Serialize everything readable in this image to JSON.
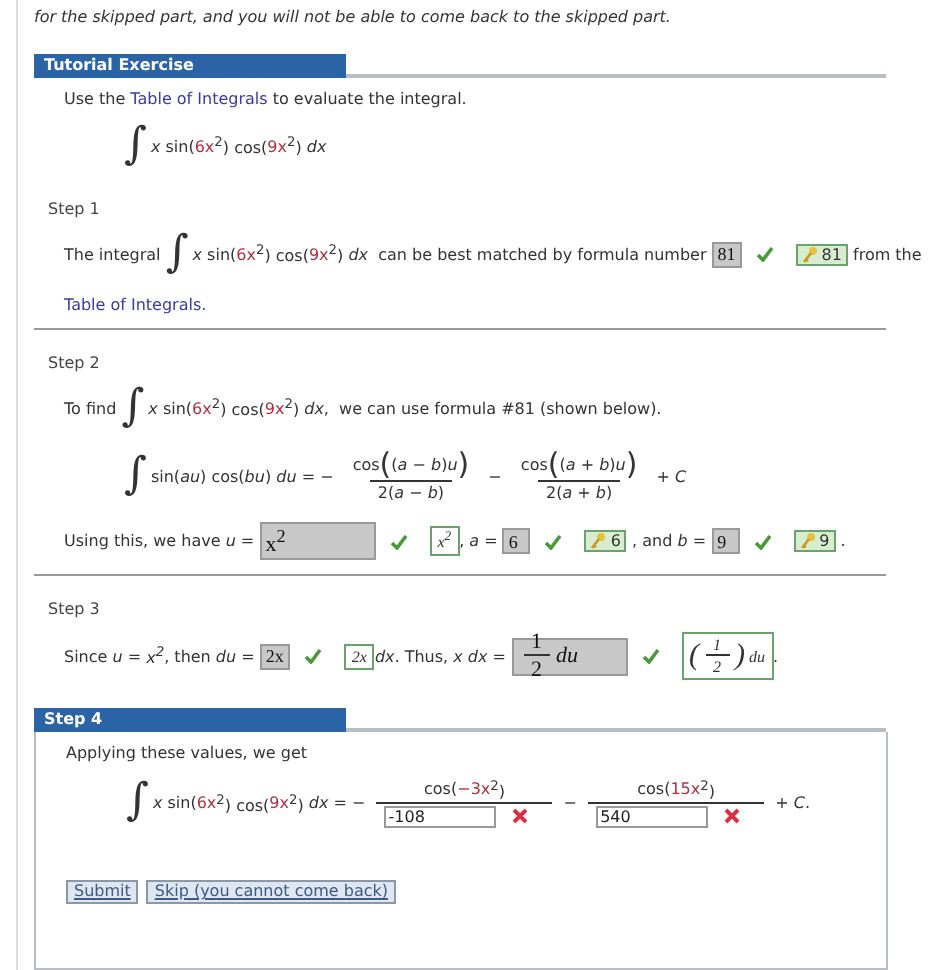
{
  "notice": "for the skipped part, and you will not be able to come back to the skipped part.",
  "tutorial": {
    "title": "Tutorial Exercise",
    "lines": [
      {
        "kind": "sentence",
        "tokens": [
          {
            "kind": "text",
            "text": "Use the "
          },
          {
            "kind": "link",
            "text": "Table of Integrals"
          },
          {
            "kind": "text",
            "text": " to evaluate the integral."
          }
        ]
      },
      {
        "kind": "display",
        "tokens": [
          {
            "kind": "int",
            "text": "∫"
          },
          {
            "kind": "var",
            "text": "x"
          },
          {
            "kind": "text",
            "text": " sin("
          },
          {
            "kind": "coef",
            "text": "6x"
          },
          {
            "kind": "text",
            "text": "$^{2}$) cos("
          },
          {
            "kind": "coef",
            "text": "9x"
          },
          {
            "kind": "text",
            "text": "$^{2}$) "
          },
          {
            "kind": "var",
            "text": "dx"
          }
        ]
      }
    ]
  },
  "steps": [
    {
      "label": "Step 1",
      "kind": "plain",
      "lines": [
        {
          "kind": "sentence",
          "tokens": [
            {
              "kind": "text",
              "text": "The integral "
            },
            {
              "kind": "int",
              "text": "∫"
            },
            {
              "kind": "var",
              "text": "x"
            },
            {
              "kind": "text",
              "text": " sin("
            },
            {
              "kind": "coef",
              "text": "6x"
            },
            {
              "kind": "text",
              "text": "$^{2}$) cos("
            },
            {
              "kind": "coef",
              "text": "9x"
            },
            {
              "kind": "text",
              "text": "$^{2}$) "
            },
            {
              "kind": "var",
              "text": "dx"
            },
            {
              "kind": "text",
              "text": "  can be best matched by formula number "
            },
            {
              "kind": "answer",
              "value": [
                {
                  "kind": "text",
                  "text": "81"
                }
              ],
              "correct": true,
              "key_icon": true,
              "key": [
                {
                  "kind": "text",
                  "text": "81"
                }
              ]
            },
            {
              "kind": "text",
              "text": " from the"
            }
          ]
        },
        {
          "kind": "sentence",
          "tokens": [
            {
              "kind": "link",
              "text": "Table of Integrals."
            }
          ]
        }
      ]
    },
    {
      "label": "Step 2",
      "kind": "plain",
      "lines": [
        {
          "kind": "sentence",
          "tokens": [
            {
              "kind": "text",
              "text": "To find "
            },
            {
              "kind": "int",
              "text": "∫"
            },
            {
              "kind": "var",
              "text": "x"
            },
            {
              "kind": "text",
              "text": " sin("
            },
            {
              "kind": "coef",
              "text": "6x"
            },
            {
              "kind": "text",
              "text": "$^{2}$) cos("
            },
            {
              "kind": "coef",
              "text": "9x"
            },
            {
              "kind": "text",
              "text": "$^{2}$) "
            },
            {
              "kind": "var",
              "text": "dx"
            },
            {
              "kind": "text",
              "text": ",  we can use formula #81 (shown below)."
            }
          ]
        },
        {
          "kind": "display",
          "tokens": [
            {
              "kind": "int",
              "text": "∫"
            },
            {
              "kind": "text",
              "text": "sin("
            },
            {
              "kind": "var",
              "text": "au"
            },
            {
              "kind": "text",
              "text": ") cos("
            },
            {
              "kind": "var",
              "text": "bu"
            },
            {
              "kind": "text",
              "text": ") "
            },
            {
              "kind": "var",
              "text": "du"
            },
            {
              "kind": "text",
              "text": " = − "
            },
            {
              "kind": "frac",
              "num": [
                {
                  "kind": "text",
                  "text": "cos"
                },
                {
                  "kind": "big",
                  "text": "("
                },
                {
                  "kind": "text",
                  "text": "("
                },
                {
                  "kind": "var",
                  "text": "a"
                },
                {
                  "kind": "text",
                  "text": " − "
                },
                {
                  "kind": "var",
                  "text": "b"
                },
                {
                  "kind": "text",
                  "text": ")"
                },
                {
                  "kind": "var",
                  "text": "u"
                },
                {
                  "kind": "big",
                  "text": ")"
                }
              ],
              "den": [
                {
                  "kind": "text",
                  "text": "2("
                },
                {
                  "kind": "var",
                  "text": "a"
                },
                {
                  "kind": "text",
                  "text": " − "
                },
                {
                  "kind": "var",
                  "text": "b"
                },
                {
                  "kind": "text",
                  "text": ")"
                }
              ]
            },
            {
              "kind": "text",
              "text": " − "
            },
            {
              "kind": "frac",
              "num": [
                {
                  "kind": "text",
                  "text": "cos"
                },
                {
                  "kind": "big",
                  "text": "("
                },
                {
                  "kind": "text",
                  "text": "("
                },
                {
                  "kind": "var",
                  "text": "a"
                },
                {
                  "kind": "text",
                  "text": " + "
                },
                {
                  "kind": "var",
                  "text": "b"
                },
                {
                  "kind": "text",
                  "text": ")"
                },
                {
                  "kind": "var",
                  "text": "u"
                },
                {
                  "kind": "big",
                  "text": ")"
                }
              ],
              "den": [
                {
                  "kind": "text",
                  "text": "2("
                },
                {
                  "kind": "var",
                  "text": "a"
                },
                {
                  "kind": "text",
                  "text": " + "
                },
                {
                  "kind": "var",
                  "text": "b"
                },
                {
                  "kind": "text",
                  "text": ")"
                }
              ]
            },
            {
              "kind": "text",
              "text": " + "
            },
            {
              "kind": "var",
              "text": "C"
            }
          ]
        },
        {
          "kind": "sentence",
          "tokens": [
            {
              "kind": "text",
              "text": "Using this, we have "
            },
            {
              "kind": "var",
              "text": "u"
            },
            {
              "kind": "text",
              "text": " = "
            },
            {
              "kind": "answer",
              "value": [
                {
                  "kind": "text",
                  "text": "x$^{2}$"
                }
              ],
              "correct": true,
              "key_icon": false,
              "key": [
                {
                  "kind": "var",
                  "text": "x$^{2}$"
                }
              ]
            },
            {
              "kind": "text",
              "text": ", "
            },
            {
              "kind": "var",
              "text": "a"
            },
            {
              "kind": "text",
              "text": " = "
            },
            {
              "kind": "answer",
              "value": [
                {
                  "kind": "text",
                  "text": "6"
                }
              ],
              "correct": true,
              "key_icon": true,
              "key": [
                {
                  "kind": "text",
                  "text": "6"
                }
              ]
            },
            {
              "kind": "text",
              "text": " , and "
            },
            {
              "kind": "var",
              "text": "b"
            },
            {
              "kind": "text",
              "text": " = "
            },
            {
              "kind": "answer",
              "value": [
                {
                  "kind": "text",
                  "text": "9"
                }
              ],
              "correct": true,
              "key_icon": true,
              "key": [
                {
                  "kind": "text",
                  "text": "9"
                }
              ]
            },
            {
              "kind": "text",
              "text": " ."
            }
          ]
        }
      ]
    },
    {
      "label": "Step 3",
      "kind": "plain",
      "lines": [
        {
          "kind": "sentence",
          "tokens": [
            {
              "kind": "text",
              "text": "Since "
            },
            {
              "kind": "var",
              "text": "u"
            },
            {
              "kind": "text",
              "text": " = "
            },
            {
              "kind": "var",
              "text": "x$^{2}$"
            },
            {
              "kind": "text",
              "text": ", then "
            },
            {
              "kind": "var",
              "text": "du"
            },
            {
              "kind": "text",
              "text": " = "
            },
            {
              "kind": "answer",
              "value": [
                {
                  "kind": "text",
                  "text": "2x"
                }
              ],
              "correct": true,
              "key_icon": false,
              "key": [
                {
                  "kind": "var",
                  "text": "2x"
                }
              ]
            },
            {
              "kind": "var",
              "text": "dx"
            },
            {
              "kind": "text",
              "text": ". Thus, "
            },
            {
              "kind": "var",
              "text": "x dx"
            },
            {
              "kind": "text",
              "text": " = "
            },
            {
              "kind": "answer",
              "value": [
                {
                  "kind": "frac",
                  "num": [
                    {
                      "kind": "text",
                      "text": "1"
                    }
                  ],
                  "den": [
                    {
                      "kind": "text",
                      "text": "2"
                    }
                  ]
                },
                {
                  "kind": "var",
                  "text": "du"
                }
              ],
              "correct": true,
              "key_icon": false,
              "key": [
                {
                  "kind": "big",
                  "text": "("
                },
                {
                  "kind": "frac",
                  "num": [
                    {
                      "kind": "text",
                      "text": "1"
                    }
                  ],
                  "den": [
                    {
                      "kind": "text",
                      "text": "2"
                    }
                  ]
                },
                {
                  "kind": "big",
                  "text": ")"
                },
                {
                  "kind": "var",
                  "text": " du"
                }
              ]
            },
            {
              "kind": "text",
              "text": "."
            }
          ]
        }
      ]
    },
    {
      "label": "Step 4",
      "kind": "banner",
      "lines": [
        {
          "kind": "sentence",
          "tokens": [
            {
              "kind": "text",
              "text": "Applying these values, we get"
            }
          ]
        },
        {
          "kind": "display",
          "tokens": [
            {
              "kind": "int",
              "text": "∫"
            },
            {
              "kind": "var",
              "text": "x"
            },
            {
              "kind": "text",
              "text": " sin("
            },
            {
              "kind": "coef",
              "text": "6x"
            },
            {
              "kind": "text",
              "text": "$^{2}$) cos("
            },
            {
              "kind": "coef",
              "text": "9x"
            },
            {
              "kind": "text",
              "text": "$^{2}$) "
            },
            {
              "kind": "var",
              "text": "dx"
            },
            {
              "kind": "text",
              "text": " = − "
            },
            {
              "kind": "frac",
              "num": [
                {
                  "kind": "text",
                  "text": "cos("
                },
                {
                  "kind": "coef",
                  "text": "−3x"
                },
                {
                  "kind": "text",
                  "text": "$^{2}$)"
                }
              ],
              "den": [
                {
                  "kind": "input",
                  "value": "-108",
                  "correct": false
                }
              ]
            },
            {
              "kind": "text",
              "text": " − "
            },
            {
              "kind": "frac",
              "num": [
                {
                  "kind": "text",
                  "text": "cos("
                },
                {
                  "kind": "coef",
                  "text": "15x"
                },
                {
                  "kind": "text",
                  "text": "$^{2}$)"
                }
              ],
              "den": [
                {
                  "kind": "input",
                  "value": "540",
                  "correct": false
                }
              ]
            },
            {
              "kind": "text",
              "text": " + "
            },
            {
              "kind": "var",
              "text": "C"
            },
            {
              "kind": "text",
              "text": "."
            }
          ]
        }
      ]
    }
  ],
  "buttons": [
    {
      "label": "Submit"
    },
    {
      "label": "Skip (you cannot come back)"
    }
  ]
}
